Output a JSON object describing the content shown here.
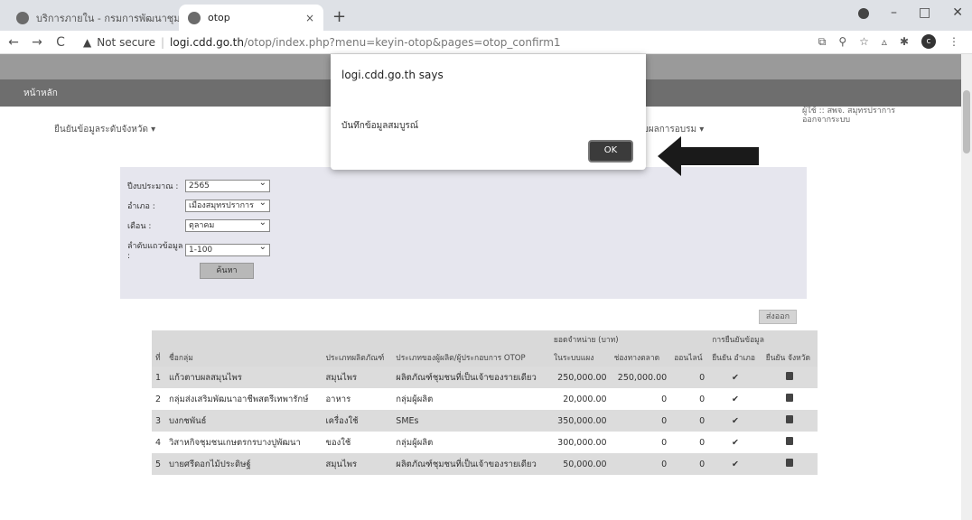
{
  "browser": {
    "tabs": [
      {
        "title": "บริการภายใน - กรมการพัฒนาชุมชน"
      },
      {
        "title": "otop"
      }
    ],
    "new_tab": "+",
    "close_symbol": "×",
    "back": "←",
    "forward": "→",
    "reload": "C",
    "security_label": "Not secure",
    "url_domain": "logi.cdd.go.th",
    "url_path": "/otop/index.php?menu=keyin-otop&pages=otop_confirm1",
    "window_controls": [
      "–",
      "□",
      "✕"
    ],
    "profile_initial": "c"
  },
  "site": {
    "nav_home": "หน้าหลัก",
    "user_line1": "ผู้ใช้ :: สพจ. สมุทรปราการ",
    "user_line2": "ออกจากระบบ",
    "menu_left": "ยืนยันข้อมูลระดับจังหวัด ▾",
    "menu_mid": "รับผลการอบรม ▾"
  },
  "filter": {
    "year_label": "ปีงบประมาณ :",
    "year_value": "2565",
    "district_label": "อำเภอ :",
    "district_value": "เมืองสมุทรปราการ",
    "month_label": "เดือน :",
    "month_value": "ตุลาคม",
    "range_label": "ลำดับแถวข้อมูล :",
    "range_value": "1-100",
    "search_label": "ค้นหา"
  },
  "export_label": "ส่งออก",
  "table": {
    "group_income": "ยอดจำหน่าย (บาท)",
    "group_confirm": "การยืนยันข้อมูล",
    "headers": {
      "no": "ที่",
      "name": "ชื่อกลุ่ม",
      "type": "ประเภทผลิตภัณฑ์",
      "producer": "ประเภทของผู้ผลิต/ผู้ประกอบการ OTOP",
      "total": "ในระบบแผง",
      "offline": "ช่องทางตลาด",
      "online": "ออนไลน์",
      "confirm": "ยืนยัน อำเภอ",
      "confirm_province": "ยืนยัน จังหวัด"
    },
    "rows": [
      {
        "no": "1",
        "name": "แก้วตาบผลสมุนไพร",
        "type": "สมุนไพร",
        "producer": "ผลิตภัณฑ์ชุมชนที่เป็นเจ้าของรายเดียว",
        "total": "250,000.00",
        "offline": "250,000.00",
        "online": "0"
      },
      {
        "no": "2",
        "name": "กลุ่มส่งเสริมพัฒนาอาชีพสตรีเทพารักษ์",
        "type": "อาหาร",
        "producer": "กลุ่มผู้ผลิต",
        "total": "20,000.00",
        "offline": "0",
        "online": "0"
      },
      {
        "no": "3",
        "name": "บงกชพันธ์",
        "type": "เครื่องใช้",
        "producer": "SMEs",
        "total": "350,000.00",
        "offline": "0",
        "online": "0"
      },
      {
        "no": "4",
        "name": "วิสาหกิจชุมชนเกษตรกรบางปูพัฒนา",
        "type": "ของใช้",
        "producer": "กลุ่มผู้ผลิต",
        "total": "300,000.00",
        "offline": "0",
        "online": "0"
      },
      {
        "no": "5",
        "name": "บายศรีดอกไม้ประดิษฐ์",
        "type": "สมุนไพร",
        "producer": "ผลิตภัณฑ์ชุมชนที่เป็นเจ้าของรายเดียว",
        "total": "50,000.00",
        "offline": "0",
        "online": "0"
      }
    ],
    "check_symbol": "✔"
  },
  "dialog": {
    "title": "logi.cdd.go.th says",
    "message": "บันทึกข้อมูลสมบูรณ์",
    "ok_label": "OK"
  }
}
